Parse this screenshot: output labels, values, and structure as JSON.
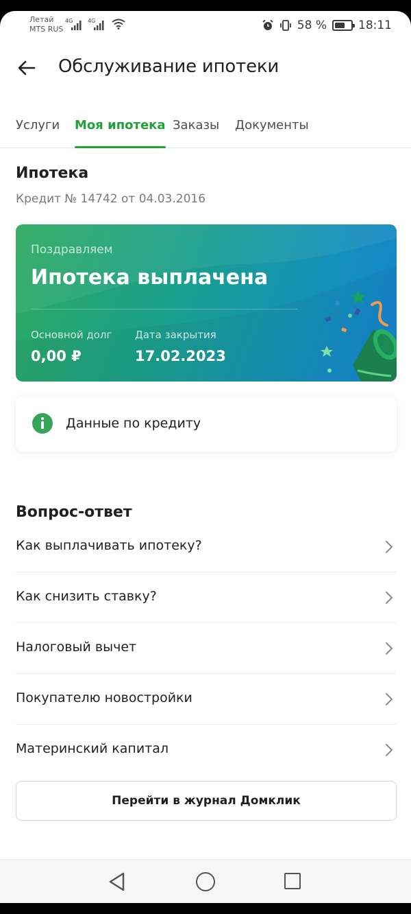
{
  "status_bar": {
    "carrier_line1": "Летай",
    "carrier_line2": "MTS RUS",
    "network1": "4G",
    "network2": "4G",
    "battery_percent": "58 %",
    "time": "18:11"
  },
  "header": {
    "title": "Обслуживание ипотеки"
  },
  "tabs": [
    {
      "label": "Услуги",
      "active": false
    },
    {
      "label": "Моя ипотека",
      "active": true
    },
    {
      "label": "Заказы",
      "active": false
    },
    {
      "label": "Документы",
      "active": false
    }
  ],
  "loan": {
    "section_title": "Ипотека",
    "subtitle": "Кредит № 14742 от 04.03.2016"
  },
  "card": {
    "congrats": "Поздравляем",
    "headline": "Ипотека выплачена",
    "principal_label": "Основной долг",
    "principal_value": "0,00 ₽",
    "close_date_label": "Дата закрытия",
    "close_date_value": "17.02.2023"
  },
  "info_tile": {
    "label": "Данные по кредиту"
  },
  "faq": {
    "title": "Вопрос-ответ",
    "items": [
      {
        "label": "Как выплачивать ипотеку?"
      },
      {
        "label": "Как снизить ставку?"
      },
      {
        "label": "Налоговый вычет"
      },
      {
        "label": "Покупателю новостройки"
      },
      {
        "label": "Материнский капитал"
      }
    ]
  },
  "journal_button": {
    "label": "Перейти в журнал Домклик"
  },
  "colors": {
    "accent": "#21a038",
    "card_gradient_start": "#2eaa5f",
    "card_gradient_end": "#1483d3"
  }
}
